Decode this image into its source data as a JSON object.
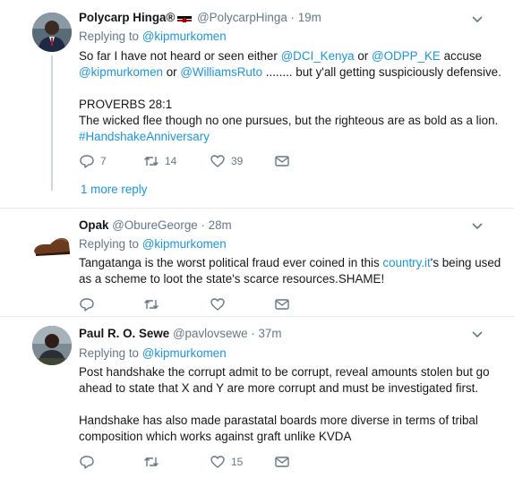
{
  "tweets": [
    {
      "name": "Polycarp Hinga®",
      "handle": "@PolycarpHinga",
      "dot": "·",
      "time": "19m",
      "replying_prefix": "Replying to",
      "replying_handle": "@kipmurkomen",
      "line1_a": "So far I have not heard or seen either ",
      "line1_link1": "@DCI_Kenya",
      "line1_b": " or ",
      "line1_link2": "@ODPP_KE",
      "line1_c": " accuse",
      "line2_link1": "@kipmurkomen",
      "line2_a": " or ",
      "line2_link2": "@WilliamsRuto",
      "line2_b": " ........ but y'all getting suspiciously defensive.",
      "line3": "PROVERBS 28:1",
      "line4": "The wicked flee though no one pursues, but the righteous are as bold as a lion.",
      "hashtag": "#HandshakeAnniversary",
      "replies": "7",
      "retweets": "14",
      "likes": "39",
      "more_reply": "1 more reply"
    },
    {
      "name": "Opak",
      "handle": "@ObureGeorge",
      "dot": "·",
      "time": "28m",
      "replying_prefix": "Replying to",
      "replying_handle": "@kipmurkomen",
      "line1_a": "Tangatanga is the worst political fraud ever coined in this ",
      "line1_link": "country.it",
      "line1_b": "'s being used",
      "line2": "as a scheme to loot the state's scarce resources.SHAME!"
    },
    {
      "name": "Paul R. O. Sewe",
      "handle": "@pavlovsewe",
      "dot": "·",
      "time": "37m",
      "replying_prefix": "Replying to",
      "replying_handle": "@kipmurkomen",
      "line1": "Post handshake the corrupt admit to be corrupt, reveal amounts stolen but go",
      "line2": "ahead to state that X and Y are more corrupt and must be investigated first.",
      "line3": "Handshake has also made parastatal boards more diverse in terms of tribal",
      "line4": "composition which works against graft unlike KVDA",
      "likes": "15"
    }
  ],
  "icons": {
    "reply": "reply-icon",
    "retweet": "retweet-icon",
    "like": "like-icon",
    "dm": "direct-message-icon",
    "caret": "chevron-down-icon",
    "flag": "kenya-flag-icon"
  },
  "colors": {
    "link": "#1b95e0",
    "secondary": "#657786",
    "text": "#14171a",
    "divider": "#e6ecf0"
  }
}
